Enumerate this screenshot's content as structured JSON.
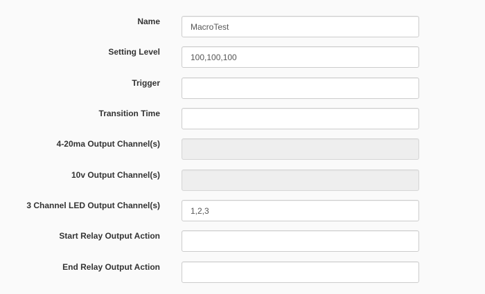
{
  "form": {
    "fields": [
      {
        "label": "Name",
        "value": "MacroTest",
        "disabled": false
      },
      {
        "label": "Setting Level",
        "value": "100,100,100",
        "disabled": false
      },
      {
        "label": "Trigger",
        "value": "",
        "disabled": false
      },
      {
        "label": "Transition Time",
        "value": "",
        "disabled": false
      },
      {
        "label": "4-20ma Output Channel(s)",
        "value": "",
        "disabled": true
      },
      {
        "label": "10v Output Channel(s)",
        "value": "",
        "disabled": true
      },
      {
        "label": "3 Channel LED Output Channel(s)",
        "value": "1,2,3",
        "disabled": false
      },
      {
        "label": "Start Relay Output Action",
        "value": "",
        "disabled": false
      },
      {
        "label": "End Relay Output Action",
        "value": "",
        "disabled": false
      }
    ]
  },
  "colors": {
    "background": "#fafafa",
    "input_border": "#cccccc",
    "disabled_fill": "#eeeeee",
    "label_text": "#333333"
  }
}
